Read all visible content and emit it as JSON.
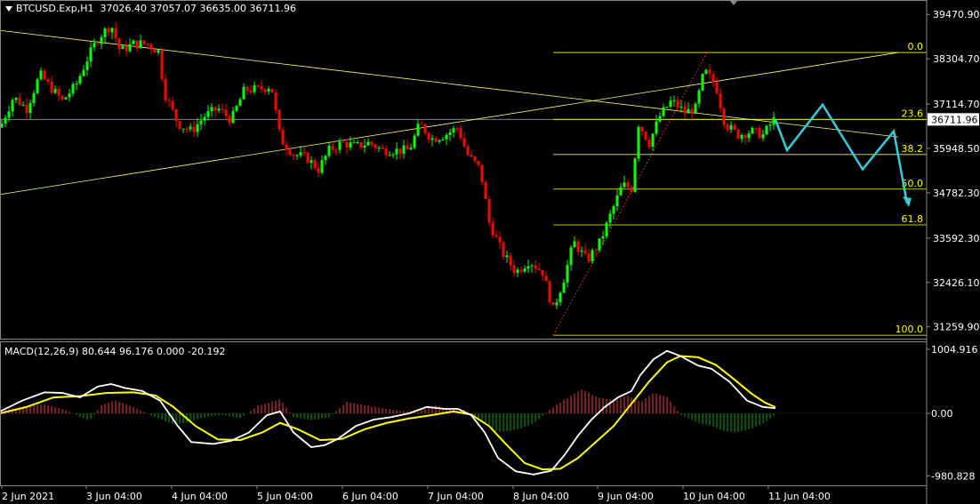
{
  "header": {
    "symbol": "BTCUSD.Exp,H1",
    "ohlc": "37026.40 37057.07 36635.00 36711.96"
  },
  "macd_header": "MACD(12,26,9) 80.644 96.176 0.000 -20.192",
  "colors": {
    "background": "#000000",
    "bull_candle": "#00ff00",
    "bear_candle": "#ff0000",
    "fib_line": "#ffff00",
    "trend_line": "#ffff66",
    "forecast": "#33ccdd",
    "macd_main": "#ffffff",
    "macd_signal": "#ffff00",
    "hist_pos": "#ff3333",
    "hist_neg": "#00aa00"
  },
  "chart_data": {
    "type": "candlestick",
    "price_axis": {
      "ticks": [
        "39470.90",
        "38304.70",
        "37114.70",
        "35948.50",
        "34782.30",
        "33592.30",
        "32426.10",
        "31259.90"
      ],
      "tick_values": [
        39470.9,
        38304.7,
        37114.7,
        35948.5,
        34782.3,
        33592.3,
        32426.1,
        31259.9
      ],
      "current_price": "36711.96",
      "range": [
        30950,
        39850
      ]
    },
    "time_axis": {
      "labels": [
        "2 Jun 2021",
        "3 Jun 04:00",
        "4 Jun 04:00",
        "5 Jun 04:00",
        "6 Jun 04:00",
        "7 Jun 04:00",
        "8 Jun 04:00",
        "9 Jun 04:00",
        "10 Jun 04:00",
        "11 Jun 04:00"
      ]
    },
    "macd_axis": {
      "ticks": [
        "1004.916",
        "0.00",
        "-980.828"
      ],
      "tick_values": [
        1004.916,
        0,
        -980.828
      ],
      "range": [
        -1130,
        1130
      ]
    },
    "fibonacci": {
      "levels": [
        {
          "label": "0.0",
          "price": 38470
        },
        {
          "label": "23.6",
          "price": 36711.96
        },
        {
          "label": "38.2",
          "price": 35790
        },
        {
          "label": "50.0",
          "price": 34880
        },
        {
          "label": "61.8",
          "price": 33940
        },
        {
          "label": "100.0",
          "price": 31040
        }
      ]
    },
    "close_path": [
      [
        0,
        36500
      ],
      [
        15,
        37300
      ],
      [
        30,
        37000
      ],
      [
        45,
        37900
      ],
      [
        55,
        37600
      ],
      [
        70,
        37200
      ],
      [
        85,
        37600
      ],
      [
        100,
        38400
      ],
      [
        112,
        38900
      ],
      [
        125,
        39200
      ],
      [
        135,
        38500
      ],
      [
        150,
        38700
      ],
      [
        165,
        38700
      ],
      [
        178,
        38500
      ],
      [
        185,
        37400
      ],
      [
        200,
        36600
      ],
      [
        215,
        36400
      ],
      [
        230,
        36800
      ],
      [
        245,
        37000
      ],
      [
        260,
        36700
      ],
      [
        275,
        37500
      ],
      [
        290,
        37500
      ],
      [
        305,
        37600
      ],
      [
        315,
        36200
      ],
      [
        330,
        35800
      ],
      [
        345,
        35700
      ],
      [
        358,
        35400
      ],
      [
        370,
        35900
      ],
      [
        385,
        36100
      ],
      [
        400,
        36000
      ],
      [
        415,
        36100
      ],
      [
        430,
        35900
      ],
      [
        445,
        35900
      ],
      [
        460,
        35900
      ],
      [
        472,
        36600
      ],
      [
        485,
        36200
      ],
      [
        500,
        36300
      ],
      [
        515,
        36500
      ],
      [
        525,
        35800
      ],
      [
        540,
        35400
      ],
      [
        550,
        34000
      ],
      [
        565,
        33200
      ],
      [
        580,
        32700
      ],
      [
        595,
        33000
      ],
      [
        610,
        32700
      ],
      [
        622,
        31700
      ],
      [
        635,
        32600
      ],
      [
        645,
        33500
      ],
      [
        660,
        33000
      ],
      [
        675,
        33500
      ],
      [
        688,
        34300
      ],
      [
        700,
        35000
      ],
      [
        710,
        34900
      ],
      [
        718,
        36600
      ],
      [
        730,
        36100
      ],
      [
        742,
        36800
      ],
      [
        755,
        37200
      ],
      [
        770,
        36900
      ],
      [
        782,
        37000
      ],
      [
        792,
        38000
      ],
      [
        805,
        37600
      ],
      [
        815,
        36600
      ],
      [
        830,
        36300
      ],
      [
        845,
        36400
      ],
      [
        858,
        36300
      ],
      [
        870,
        36700
      ]
    ],
    "forecast": [
      [
        872,
        36700
      ],
      [
        885,
        35900
      ],
      [
        925,
        37100
      ],
      [
        970,
        35400
      ],
      [
        1005,
        36400
      ],
      [
        1020,
        34500
      ]
    ],
    "trend_lines": [
      {
        "from": [
          0,
          39050
        ],
        "to": [
          1010,
          36250
        ]
      },
      {
        "from": [
          0,
          34740
        ],
        "to": [
          1010,
          38470
        ]
      }
    ],
    "zigzag": [
      [
        622,
        31040
      ],
      [
        795,
        38470
      ]
    ],
    "macd_main": [
      [
        0,
        30
      ],
      [
        25,
        200
      ],
      [
        50,
        330
      ],
      [
        70,
        320
      ],
      [
        90,
        250
      ],
      [
        110,
        420
      ],
      [
        125,
        460
      ],
      [
        140,
        400
      ],
      [
        160,
        350
      ],
      [
        180,
        200
      ],
      [
        200,
        -200
      ],
      [
        215,
        -450
      ],
      [
        240,
        -480
      ],
      [
        260,
        -430
      ],
      [
        280,
        -300
      ],
      [
        300,
        -30
      ],
      [
        315,
        30
      ],
      [
        330,
        -300
      ],
      [
        350,
        -530
      ],
      [
        365,
        -500
      ],
      [
        380,
        -400
      ],
      [
        400,
        -200
      ],
      [
        420,
        -100
      ],
      [
        440,
        -60
      ],
      [
        460,
        0
      ],
      [
        480,
        100
      ],
      [
        500,
        70
      ],
      [
        515,
        70
      ],
      [
        530,
        -30
      ],
      [
        545,
        -300
      ],
      [
        560,
        -700
      ],
      [
        580,
        -910
      ],
      [
        600,
        -960
      ],
      [
        620,
        -900
      ],
      [
        635,
        -650
      ],
      [
        650,
        -350
      ],
      [
        665,
        -100
      ],
      [
        680,
        100
      ],
      [
        695,
        250
      ],
      [
        710,
        350
      ],
      [
        720,
        600
      ],
      [
        735,
        850
      ],
      [
        750,
        980
      ],
      [
        765,
        900
      ],
      [
        785,
        750
      ],
      [
        800,
        700
      ],
      [
        820,
        500
      ],
      [
        840,
        200
      ],
      [
        858,
        100
      ],
      [
        872,
        80
      ]
    ],
    "macd_signal": [
      [
        0,
        0
      ],
      [
        30,
        100
      ],
      [
        60,
        250
      ],
      [
        90,
        270
      ],
      [
        120,
        320
      ],
      [
        150,
        330
      ],
      [
        175,
        280
      ],
      [
        195,
        100
      ],
      [
        220,
        -200
      ],
      [
        245,
        -410
      ],
      [
        270,
        -420
      ],
      [
        295,
        -300
      ],
      [
        315,
        -150
      ],
      [
        335,
        -250
      ],
      [
        360,
        -420
      ],
      [
        385,
        -400
      ],
      [
        410,
        -250
      ],
      [
        435,
        -150
      ],
      [
        460,
        -80
      ],
      [
        485,
        -30
      ],
      [
        510,
        30
      ],
      [
        530,
        -20
      ],
      [
        550,
        -200
      ],
      [
        570,
        -500
      ],
      [
        590,
        -780
      ],
      [
        610,
        -880
      ],
      [
        630,
        -870
      ],
      [
        650,
        -700
      ],
      [
        670,
        -450
      ],
      [
        690,
        -200
      ],
      [
        710,
        150
      ],
      [
        730,
        500
      ],
      [
        750,
        800
      ],
      [
        765,
        900
      ],
      [
        785,
        880
      ],
      [
        805,
        760
      ],
      [
        825,
        540
      ],
      [
        845,
        310
      ],
      [
        860,
        170
      ],
      [
        872,
        96
      ]
    ],
    "macd_hist_peaks": [
      [
        0,
        40
      ],
      [
        25,
        110
      ],
      [
        50,
        140
      ],
      [
        70,
        70
      ],
      [
        85,
        -20
      ],
      [
        100,
        -120
      ],
      [
        115,
        140
      ],
      [
        130,
        200
      ],
      [
        150,
        100
      ],
      [
        175,
        -60
      ],
      [
        195,
        -180
      ],
      [
        210,
        -150
      ],
      [
        230,
        -60
      ],
      [
        250,
        -20
      ],
      [
        270,
        -80
      ],
      [
        290,
        120
      ],
      [
        315,
        220
      ],
      [
        330,
        -60
      ],
      [
        350,
        -110
      ],
      [
        370,
        -60
      ],
      [
        390,
        180
      ],
      [
        410,
        130
      ],
      [
        430,
        80
      ],
      [
        450,
        40
      ],
      [
        470,
        20
      ],
      [
        490,
        130
      ],
      [
        505,
        60
      ],
      [
        520,
        80
      ],
      [
        540,
        -120
      ],
      [
        560,
        -300
      ],
      [
        580,
        -260
      ],
      [
        600,
        -160
      ],
      [
        620,
        80
      ],
      [
        640,
        260
      ],
      [
        655,
        380
      ],
      [
        670,
        260
      ],
      [
        690,
        200
      ],
      [
        705,
        280
      ],
      [
        720,
        180
      ],
      [
        735,
        320
      ],
      [
        750,
        260
      ],
      [
        765,
        -20
      ],
      [
        785,
        -150
      ],
      [
        800,
        -200
      ],
      [
        815,
        -280
      ],
      [
        830,
        -300
      ],
      [
        845,
        -240
      ],
      [
        860,
        -140
      ],
      [
        872,
        -20
      ]
    ]
  }
}
